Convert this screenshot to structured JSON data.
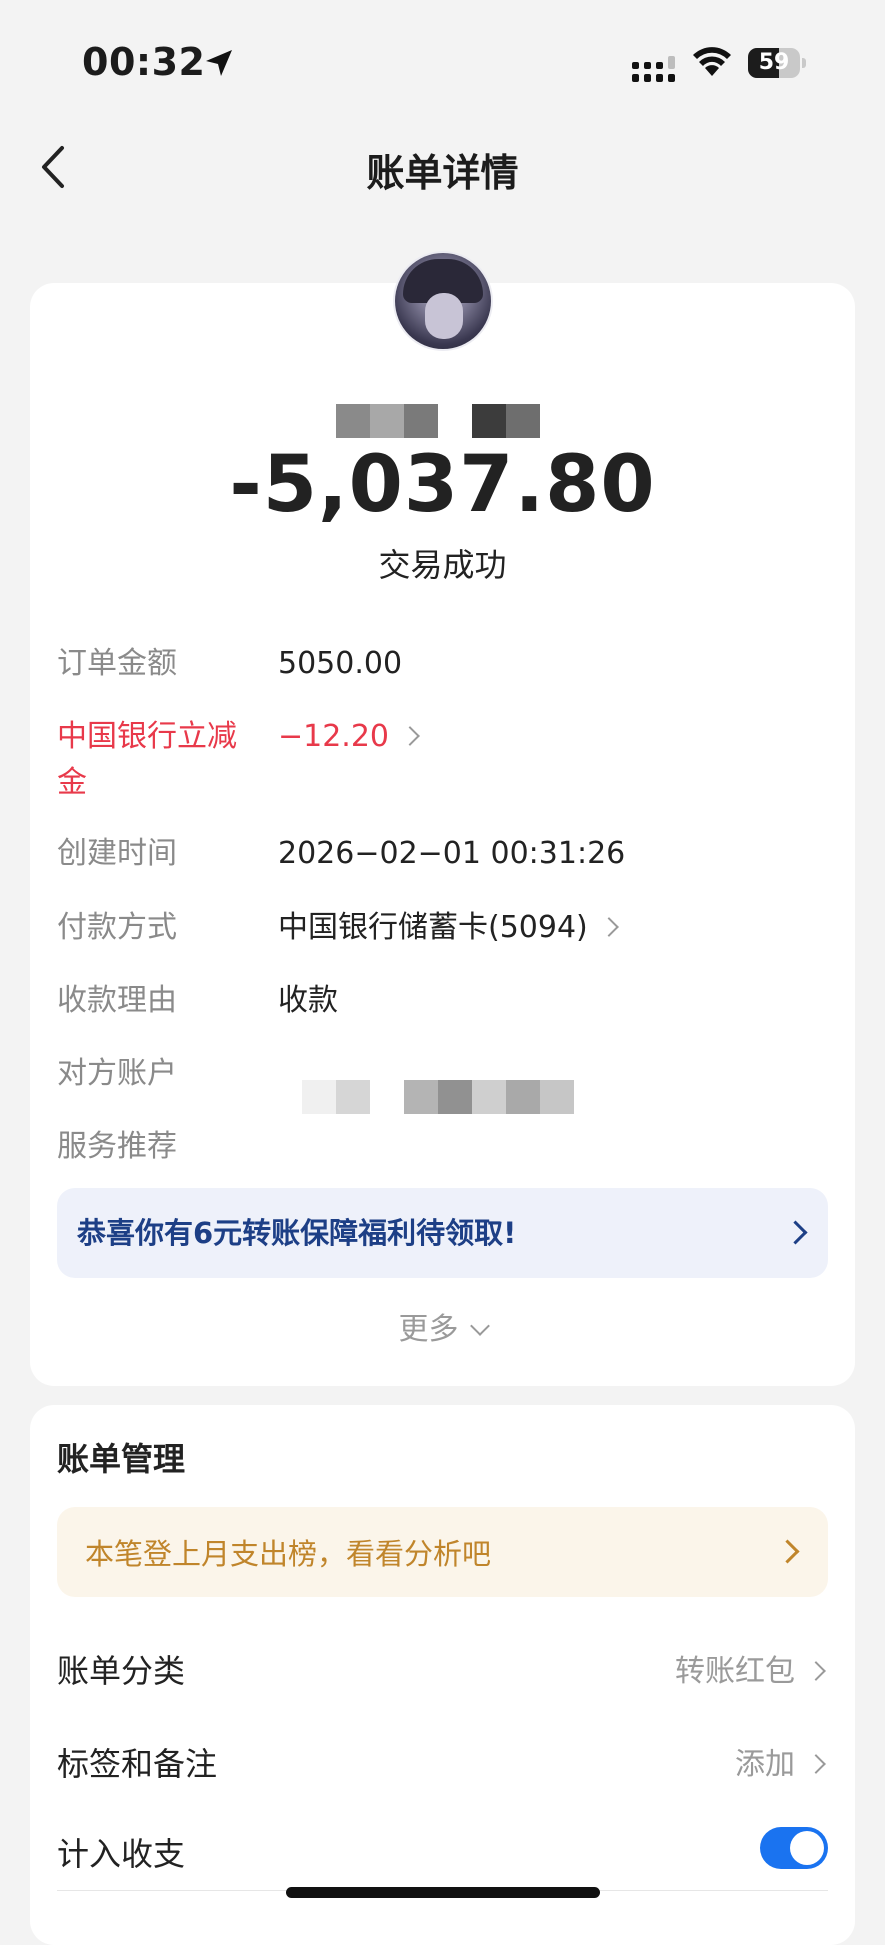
{
  "status_bar": {
    "time": "00:32",
    "battery": "59",
    "battery_level": 0.59
  },
  "nav": {
    "title": "账单详情"
  },
  "transaction": {
    "amount": "-5,037.80",
    "status": "交易成功"
  },
  "details": [
    {
      "label": "订单金额",
      "value": "5050.00"
    },
    {
      "label_line1": "中国银行立减",
      "label_line2": "金",
      "value": "−12.20"
    },
    {
      "label": "创建时间",
      "value": "2026−02−01 00:31:26"
    },
    {
      "label": "付款方式",
      "value": "中国银行储蓄卡(5094)"
    },
    {
      "label": "收款理由",
      "value": "收款"
    },
    {
      "label": "对方账户"
    },
    {
      "label": "服务推荐"
    }
  ],
  "promo": {
    "text": "恭喜你有6元转账保障福利待领取!"
  },
  "more_label": "更多",
  "bill_management": {
    "title": "账单管理",
    "notice": "本笔登上月支出榜，看看分析吧",
    "category_label": "账单分类",
    "category_value": "转账红包",
    "tags_label": "标签和备注",
    "tags_value": "添加",
    "count_label": "计入收支",
    "count_enabled": true
  },
  "colors": {
    "accent_blue": "#1a73f0",
    "discount_red": "#e8394a",
    "promo_text": "#1d3f86",
    "notice_text": "#c0852b"
  }
}
